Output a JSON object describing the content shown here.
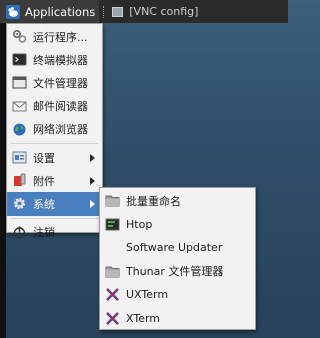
{
  "panel": {
    "applications_label": "Applications",
    "task_label": "[VNC config]"
  },
  "main_menu": {
    "items": [
      {
        "label": "运行程序...",
        "icon": "run-icon"
      },
      {
        "label": "终端模拟器",
        "icon": "terminal-icon"
      },
      {
        "label": "文件管理器",
        "icon": "file-manager-icon"
      },
      {
        "label": "邮件阅读器",
        "icon": "mail-icon"
      },
      {
        "label": "网络浏览器",
        "icon": "globe-icon"
      },
      {
        "label": "设置",
        "icon": "settings-icon",
        "submenu": true
      },
      {
        "label": "附件",
        "icon": "accessories-icon",
        "submenu": true
      },
      {
        "label": "系统",
        "icon": "system-gear-icon",
        "submenu": true,
        "active": true
      },
      {
        "label": "注销",
        "icon": "logout-icon"
      }
    ]
  },
  "system_submenu": {
    "items": [
      {
        "label": "批量重命名",
        "icon": "folder-icon"
      },
      {
        "label": "Htop",
        "icon": "htop-icon"
      },
      {
        "label": "Software Updater",
        "icon": "none"
      },
      {
        "label": "Thunar 文件管理器",
        "icon": "folder-icon"
      },
      {
        "label": "UXTerm",
        "icon": "xterm-icon"
      },
      {
        "label": "XTerm",
        "icon": "xterm-icon"
      }
    ]
  },
  "colors": {
    "highlight": "#4a7fbf",
    "menu_bg": "#f2f2f2",
    "panel_bg": "#2a2a2a"
  }
}
